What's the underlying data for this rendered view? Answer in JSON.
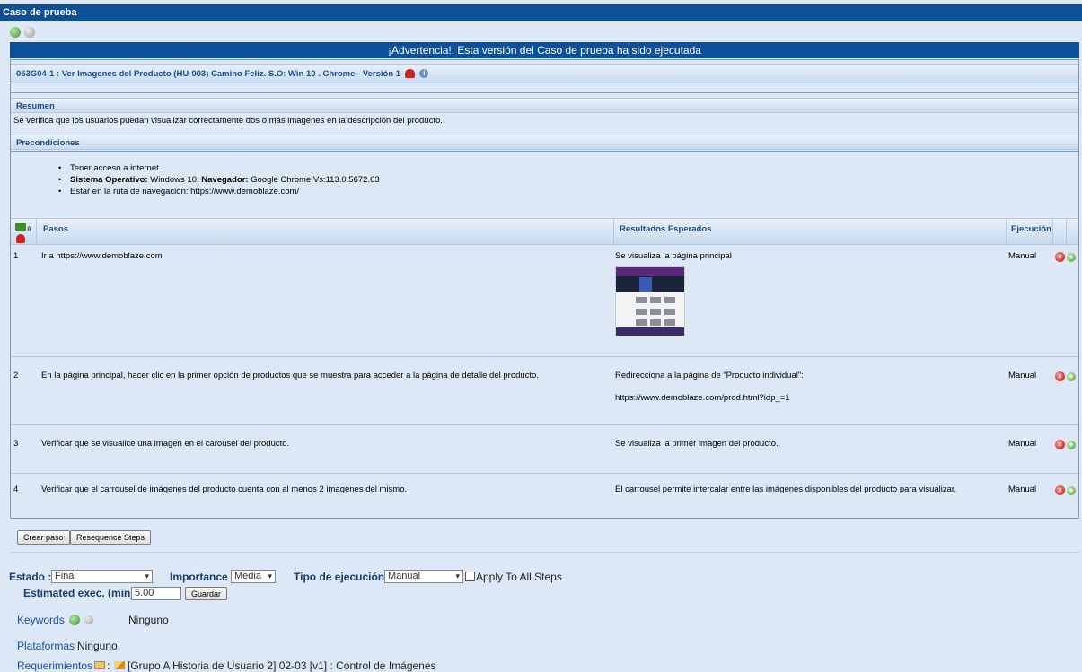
{
  "window": {
    "title": "Caso de prueba"
  },
  "warning": "¡Advertencia!: Esta versión del Caso de prueba ha sido ejecutada",
  "testcase": {
    "title": "053G04-1 : Ver Imagenes del Producto (HU-003) Camino Feliz. S.O: Win 10 . Chrome - Versión 1",
    "summary_header": "Resumen",
    "summary": "Se verifica que los usuarios puedan visualizar correctamente dos o más imagenes en la descripción del producto.",
    "precond_header": "Precondiciones",
    "preconditions": {
      "item1": "Tener acceso a internet.",
      "item2_label1": "Sistema Operativo:",
      "item2_value1": " Windows 10. ",
      "item2_label2": "Navegador:",
      "item2_value2": " Google Chrome Vs:113.0.5672.63",
      "item3": "Estar en la ruta de navegación:  https://www.demoblaze.com/"
    }
  },
  "steps_table": {
    "headers": {
      "num": "#",
      "steps": "Pasos",
      "expected": "Resultados Esperados",
      "execution": "Ejecución"
    },
    "rows": [
      {
        "num": "1",
        "action": "Ir a https://www.demoblaze.com",
        "expected": "Se visualiza la página principal",
        "expected2": "",
        "execution": "Manual"
      },
      {
        "num": "2",
        "action": "En la página principal, hacer clic en la primer opción de productos que se muestra para acceder a la página de detalle del producto.",
        "expected": "Redirecciona a la página de “Producto individual”:",
        "expected2": "https://www.demoblaze.com/prod.html?idp_=1",
        "execution": "Manual"
      },
      {
        "num": "3",
        "action": "Verificar que se visualice una imagen en el carousel del producto.",
        "expected": "Se visualiza la primer imagen del producto.",
        "expected2": "",
        "execution": "Manual"
      },
      {
        "num": "4",
        "action": "Verificar que el carrousel de imágenes del producto cuenta con al menos 2 imagenes del mismo.",
        "expected": "El carrousel permite intercalar entre las imágenes disponibles del producto para visualizar.",
        "expected2": "",
        "execution": "Manual"
      }
    ]
  },
  "buttons": {
    "create_step": "Crear paso",
    "resequence": "Resequence Steps",
    "save": "Guardar"
  },
  "form": {
    "estado_label": "Estado :",
    "estado_value": "Final",
    "importance_label": "Importance :",
    "importance_value": "Media",
    "exec_type_label": "Tipo de ejecución :",
    "exec_type_value": "Manual",
    "apply_all": "Apply To All Steps",
    "est_exec_label": "Estimated exec. (min) :",
    "est_exec_value": "5.00"
  },
  "keywords": {
    "label": "Keywords",
    "value": "Ninguno"
  },
  "platforms": {
    "label": "Plataformas",
    "value": "Ninguno"
  },
  "requirements": {
    "label": "Requerimientos",
    "value": "[Grupo A Historia de Usuario 2] 02-03 [v1] : Control de Imágenes"
  }
}
